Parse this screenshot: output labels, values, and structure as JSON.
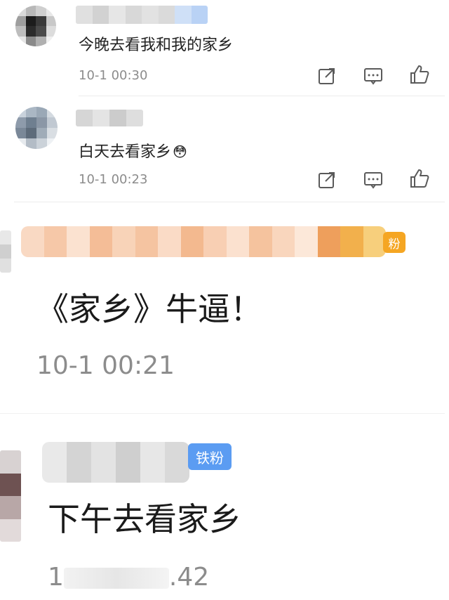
{
  "comments": [
    {
      "text": "今晚去看我和我的家乡",
      "time": "10-1 00:30",
      "actions": [
        "share-icon",
        "reply-icon",
        "like-icon"
      ]
    },
    {
      "text": "白天去看家乡",
      "emoji": "😳",
      "time": "10-1 00:23",
      "actions": [
        "share-icon",
        "reply-icon",
        "like-icon"
      ]
    },
    {
      "text": "《家乡》牛逼！",
      "time": "10-1 00:21",
      "badge": "粉"
    },
    {
      "text": "下午去看家乡",
      "time_start": "1",
      "time_end": ".42",
      "badge": "铁粉"
    }
  ],
  "colors": {
    "time_gray": "#8c8c8c",
    "icon_gray": "#5a5a5a",
    "fan_badge": "#f5a623",
    "iron_fan_badge": "#5b9cf2"
  }
}
